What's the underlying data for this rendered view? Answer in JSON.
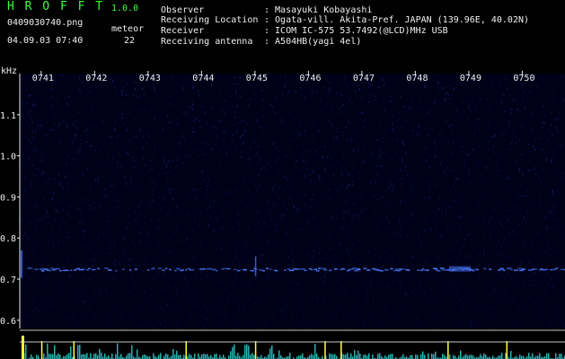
{
  "app": {
    "title": "H R O F F T",
    "version": "1.0.0",
    "filename": "0409030740.png",
    "datetime": "04.09.03 07:40",
    "meteor_label": "meteor",
    "meteor_count": "22"
  },
  "info": {
    "rows": [
      {
        "label": "Observer",
        "value": ": Masayuki Kobayashi"
      },
      {
        "label": "Receiving Location",
        "value": ": Ogata-vill. Akita-Pref. JAPAN (139.96E, 40.02N)"
      },
      {
        "label": "Receiver",
        "value": ": ICOM IC-575 53.7492(@LCD)MHz USB"
      },
      {
        "label": "Receiving antenna",
        "value": ": A504HB(yagi 4el)"
      }
    ]
  },
  "chart_data": {
    "type": "heatmap",
    "ylabel": "kHz",
    "y_ticks": [
      "1.1",
      "1.0",
      "0.9",
      "0.8",
      "0.7",
      "0.6"
    ],
    "y_tick_values": [
      1.1,
      1.0,
      0.9,
      0.8,
      0.7,
      0.6
    ],
    "ylim": [
      0.58,
      1.2
    ],
    "x_ticks": [
      "0741",
      "0742",
      "0743",
      "0744",
      "0745",
      "0746",
      "0747",
      "0748",
      "0749",
      "0750"
    ],
    "x_tick_values": [
      741,
      742,
      743,
      744,
      745,
      746,
      747,
      748,
      749,
      750
    ],
    "xlim": [
      740.6,
      750.8
    ],
    "carrier_khz": 0.725,
    "colors": {
      "background": "#000018",
      "noise": "#1c2c8a",
      "carrier": "#4a7aff",
      "label": "#f0f0f0",
      "histogram_low": "#2ad0d0",
      "histogram_high": "#ffff40",
      "divider": "#c8c8c8"
    },
    "events": [
      {
        "time": 745.0,
        "kind": "vertical-trace"
      },
      {
        "time": 748.8,
        "kind": "strong-burst"
      }
    ]
  }
}
